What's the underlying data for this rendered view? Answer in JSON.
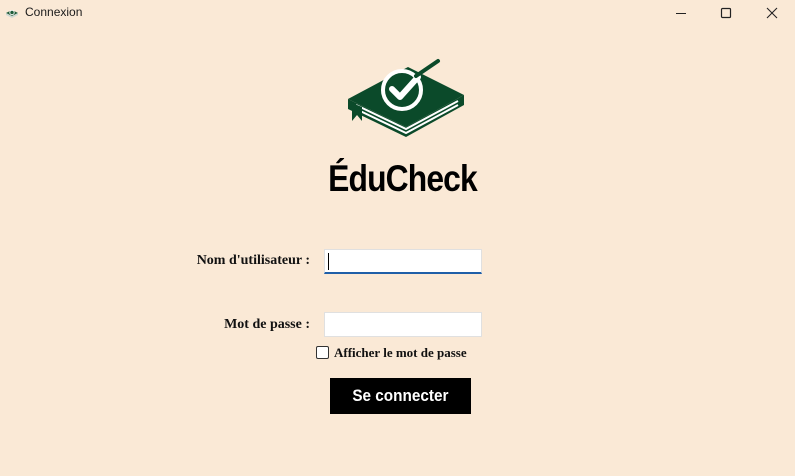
{
  "window": {
    "title": "Connexion",
    "icon": "book-check-icon",
    "controls": [
      "minimize-icon",
      "maximize-icon",
      "close-icon"
    ]
  },
  "app": {
    "name": "ÉduCheck",
    "logo": "book-checkmark-logo",
    "brand_color": "#0b4a2a"
  },
  "form": {
    "username_label": "Nom d'utilisateur :",
    "username_value": "",
    "password_label": "Mot de passe :",
    "password_value": "",
    "show_password_label": "Afficher le mot de passe",
    "show_password_checked": false,
    "submit_label": "Se connecter"
  },
  "colors": {
    "background": "#fae9d6",
    "button": "#000000",
    "button_text": "#ffffff",
    "focus_border": "#1f5fa8"
  }
}
